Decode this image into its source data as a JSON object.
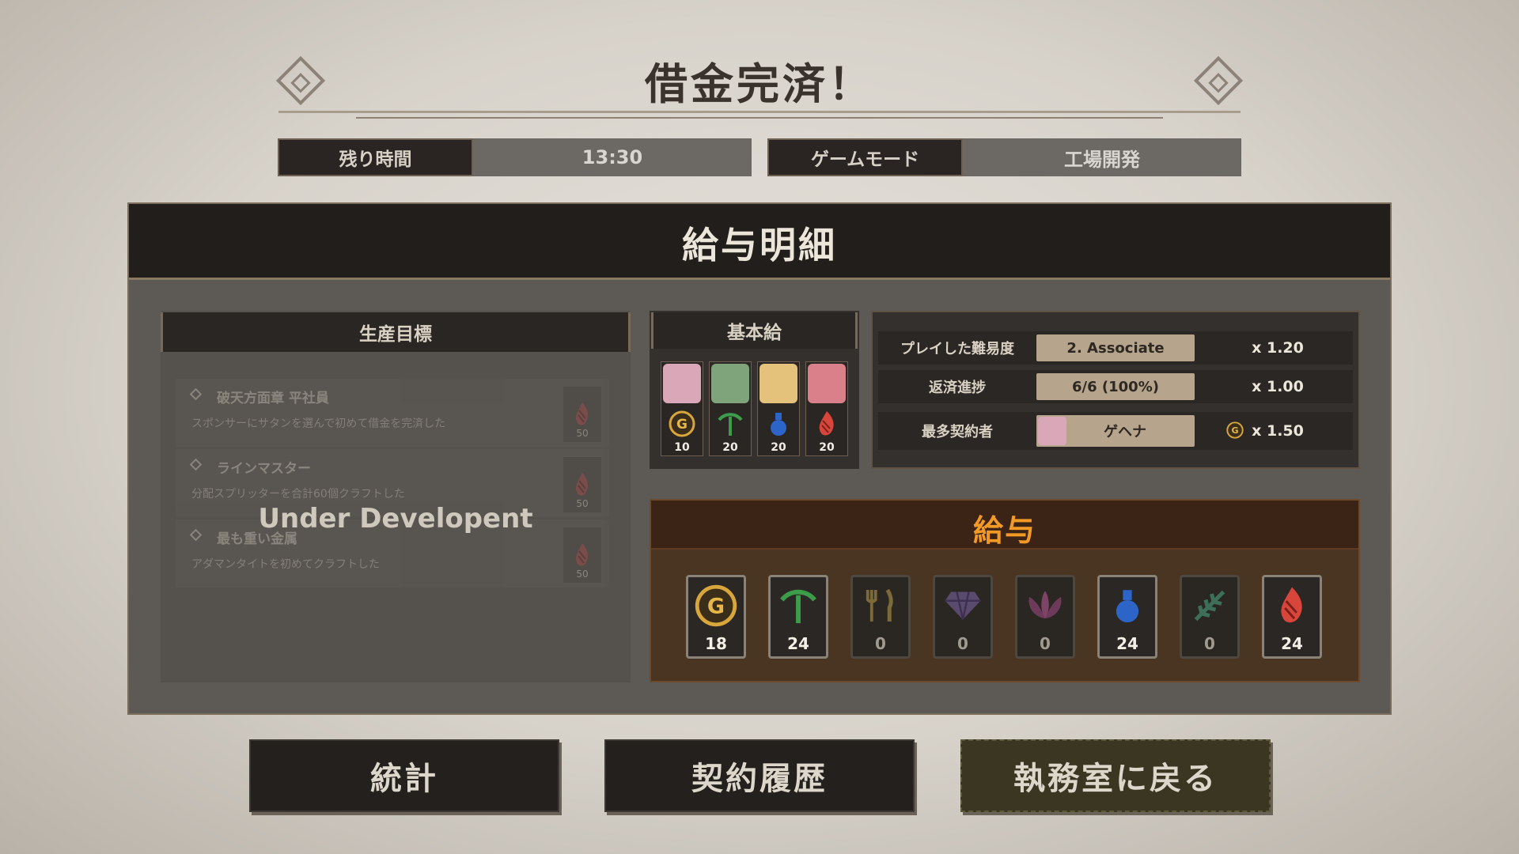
{
  "title": "借金完済！",
  "info": {
    "time_label": "残り時間",
    "time_value": "13:30",
    "mode_label": "ゲームモード",
    "mode_value": "工場開発"
  },
  "panel": {
    "title": "給与明細"
  },
  "production": {
    "header": "生産目標",
    "overlay": "Under Developent",
    "items": [
      {
        "name": "破天方面章 平社員",
        "desc": "スポンサーにサタンを選んで初めて借金を完済した",
        "badge": "50",
        "badge_icon": "flame-icon"
      },
      {
        "name": "ラインマスター",
        "desc": "分配スプリッターを合計60個クラフトした",
        "badge": "50",
        "badge_icon": "flame-icon"
      },
      {
        "name": "最も重い金属",
        "desc": "アダマンタイトを初めてクラフトした",
        "badge": "50",
        "badge_icon": "flame-icon"
      }
    ]
  },
  "base_pay": {
    "header": "基本給",
    "cards": [
      {
        "value": "10",
        "icon": "coin-icon",
        "portrait_color": "#d9a7b8"
      },
      {
        "value": "20",
        "icon": "pickaxe-icon",
        "portrait_color": "#7fa37a"
      },
      {
        "value": "20",
        "icon": "potion-icon",
        "portrait_color": "#e4c27b"
      },
      {
        "value": "20",
        "icon": "flame-icon",
        "portrait_color": "#d9808a"
      }
    ]
  },
  "multipliers": [
    {
      "label": "プレイした難易度",
      "value": "2. Associate",
      "mult": "x 1.20"
    },
    {
      "label": "返済進捗",
      "value": "6/6 (100%)",
      "mult": "x 1.00"
    },
    {
      "label": "最多契約者",
      "value": "ゲヘナ",
      "mult": "x 1.50",
      "has_portrait": true,
      "mult_icon": "coin-icon"
    }
  ],
  "salary": {
    "title": "給与",
    "items": [
      {
        "icon": "coin-icon",
        "value": "18"
      },
      {
        "icon": "pickaxe-icon",
        "value": "24"
      },
      {
        "icon": "fork-knife-icon",
        "value": "0"
      },
      {
        "icon": "gem-icon",
        "value": "0"
      },
      {
        "icon": "flower-icon",
        "value": "0"
      },
      {
        "icon": "potion-icon",
        "value": "24"
      },
      {
        "icon": "leaf-icon",
        "value": "0"
      },
      {
        "icon": "flame-icon",
        "value": "24"
      }
    ]
  },
  "buttons": {
    "stats": "統計",
    "history": "契約履歴",
    "back": "執務室に戻る"
  },
  "colors": {
    "salary_title": "#f39a26",
    "accent_tan": "#b6a48c"
  }
}
